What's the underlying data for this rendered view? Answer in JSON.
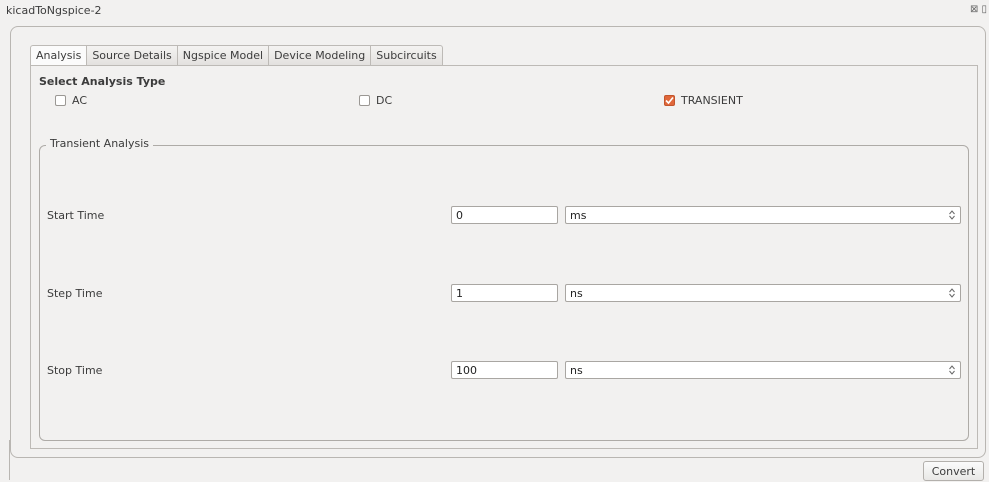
{
  "window": {
    "title": "kicadToNgspice-2",
    "corner_icons": "⊠ ▯"
  },
  "tabs": [
    {
      "label": "Analysis",
      "active": true
    },
    {
      "label": "Source Details",
      "active": false
    },
    {
      "label": "Ngspice Model",
      "active": false
    },
    {
      "label": "Device Modeling",
      "active": false
    },
    {
      "label": "Subcircuits",
      "active": false
    }
  ],
  "analysis": {
    "section_title": "Select Analysis Type",
    "options": [
      {
        "label": "AC",
        "checked": false
      },
      {
        "label": "DC",
        "checked": false
      },
      {
        "label": "TRANSIENT",
        "checked": true
      }
    ]
  },
  "transient": {
    "group_title": "Transient Analysis",
    "rows": [
      {
        "label": "Start Time",
        "value": "0",
        "unit": "ms"
      },
      {
        "label": "Step Time",
        "value": "1",
        "unit": "ns"
      },
      {
        "label": "Stop Time",
        "value": "100",
        "unit": "ns"
      }
    ]
  },
  "footer": {
    "convert_label": "Convert"
  },
  "colors": {
    "accent": "#e0673a",
    "background": "#f2f1f0"
  }
}
